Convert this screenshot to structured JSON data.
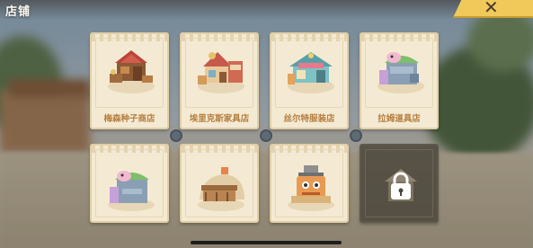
{
  "header": {
    "title": "店铺"
  },
  "close_button": {
    "icon": "close-icon",
    "glyph": "✕"
  },
  "shops": [
    {
      "label": "梅森种子商店",
      "icon": "seed-shop-icon",
      "locked": false
    },
    {
      "label": "埃里克斯家具店",
      "icon": "furniture-shop-icon",
      "locked": false
    },
    {
      "label": "丝尔特服装店",
      "icon": "clothing-shop-icon",
      "locked": false
    },
    {
      "label": "拉姆道具店",
      "icon": "item-shop-icon",
      "locked": false
    },
    {
      "label": "",
      "icon": "machine-shop-icon",
      "locked": false
    },
    {
      "label": "",
      "icon": "stall-shop-icon",
      "locked": false
    },
    {
      "label": "",
      "icon": "robot-shop-icon",
      "locked": false
    },
    {
      "label": "",
      "icon": "lock-icon",
      "locked": true
    }
  ],
  "colors": {
    "accent": "#f1c95a",
    "label": "#b57e3f",
    "card": "#f4ead3"
  }
}
